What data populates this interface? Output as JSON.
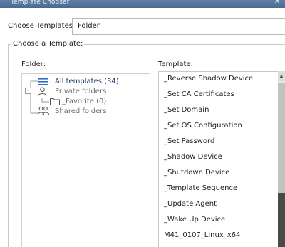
{
  "window": {
    "title": "Template Chooser",
    "close_glyph": "✕"
  },
  "chooser": {
    "label": "Choose Templates by:",
    "selected": "Folder"
  },
  "group": {
    "legend": "Choose a Template:"
  },
  "folder_section": {
    "label": "Folder:",
    "tree": [
      {
        "label": "All templates (34)",
        "icon": "list-icon",
        "selected": true
      },
      {
        "label": "Private folders",
        "icon": "person-icon",
        "expander": "-"
      },
      {
        "label": "_Favorite (0)",
        "icon": "folder-icon"
      },
      {
        "label": "Shared folders",
        "icon": "people-icon"
      }
    ]
  },
  "template_section": {
    "label": "Template:",
    "items": [
      "_Reverse Shadow Device",
      "_Set CA Certificates",
      "_Set Domain",
      "_Set OS Configuration",
      "_Set Password",
      "_Shadow Device",
      "_Shutdown Device",
      "_Template Sequence",
      "_Update Agent",
      "_Wake Up Device",
      "M41_0107_Linux_x64"
    ]
  },
  "colors": {
    "titlebar": "#4f6f98",
    "selected_text": "#1f3a6b",
    "tree_text": "#6b6b6b",
    "list_icon": "#2a6fc9",
    "scroll_dark": "#4a4a4a"
  }
}
